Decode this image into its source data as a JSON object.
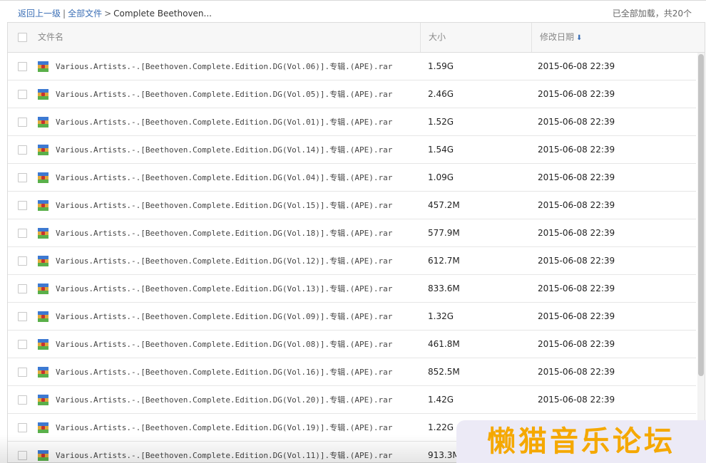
{
  "breadcrumb": {
    "back": "返回上一级",
    "separator": "|",
    "all_files": "全部文件",
    "arrow": ">",
    "current": "Complete Beethoven..."
  },
  "status": {
    "loaded": "已全部加载，共20个"
  },
  "columns": {
    "name": "文件名",
    "size": "大小",
    "date": "修改日期",
    "sort_icon": "arrow-down"
  },
  "files": [
    {
      "name": "Various.Artists.-.[Beethoven.Complete.Edition.DG(Vol.06)].专辑.(APE).rar",
      "size": "1.59G",
      "date": "2015-06-08 22:39"
    },
    {
      "name": "Various.Artists.-.[Beethoven.Complete.Edition.DG(Vol.05)].专辑.(APE).rar",
      "size": "2.46G",
      "date": "2015-06-08 22:39"
    },
    {
      "name": "Various.Artists.-.[Beethoven.Complete.Edition.DG(Vol.01)].专辑.(APE).rar",
      "size": "1.52G",
      "date": "2015-06-08 22:39"
    },
    {
      "name": "Various.Artists.-.[Beethoven.Complete.Edition.DG(Vol.14)].专辑.(APE).rar",
      "size": "1.54G",
      "date": "2015-06-08 22:39"
    },
    {
      "name": "Various.Artists.-.[Beethoven.Complete.Edition.DG(Vol.04)].专辑.(APE).rar",
      "size": "1.09G",
      "date": "2015-06-08 22:39"
    },
    {
      "name": "Various.Artists.-.[Beethoven.Complete.Edition.DG(Vol.15)].专辑.(APE).rar",
      "size": "457.2M",
      "date": "2015-06-08 22:39"
    },
    {
      "name": "Various.Artists.-.[Beethoven.Complete.Edition.DG(Vol.18)].专辑.(APE).rar",
      "size": "577.9M",
      "date": "2015-06-08 22:39"
    },
    {
      "name": "Various.Artists.-.[Beethoven.Complete.Edition.DG(Vol.12)].专辑.(APE).rar",
      "size": "612.7M",
      "date": "2015-06-08 22:39"
    },
    {
      "name": "Various.Artists.-.[Beethoven.Complete.Edition.DG(Vol.13)].专辑.(APE).rar",
      "size": "833.6M",
      "date": "2015-06-08 22:39"
    },
    {
      "name": "Various.Artists.-.[Beethoven.Complete.Edition.DG(Vol.09)].专辑.(APE).rar",
      "size": "1.32G",
      "date": "2015-06-08 22:39"
    },
    {
      "name": "Various.Artists.-.[Beethoven.Complete.Edition.DG(Vol.08)].专辑.(APE).rar",
      "size": "461.8M",
      "date": "2015-06-08 22:39"
    },
    {
      "name": "Various.Artists.-.[Beethoven.Complete.Edition.DG(Vol.16)].专辑.(APE).rar",
      "size": "852.5M",
      "date": "2015-06-08 22:39"
    },
    {
      "name": "Various.Artists.-.[Beethoven.Complete.Edition.DG(Vol.20)].专辑.(APE).rar",
      "size": "1.42G",
      "date": "2015-06-08 22:39"
    },
    {
      "name": "Various.Artists.-.[Beethoven.Complete.Edition.DG(Vol.19)].专辑.(APE).rar",
      "size": "1.22G",
      "date": ""
    },
    {
      "name": "Various.Artists.-.[Beethoven.Complete.Edition.DG(Vol.11)].专辑.(APE).rar",
      "size": "913.3M",
      "date": ""
    }
  ],
  "file_icon": "rar-archive-icon",
  "watermark": "懒猫音乐论坛",
  "colors": {
    "link": "#3b6fb6",
    "watermark": "#f5a800",
    "header_bg": "#f7f7f7"
  }
}
